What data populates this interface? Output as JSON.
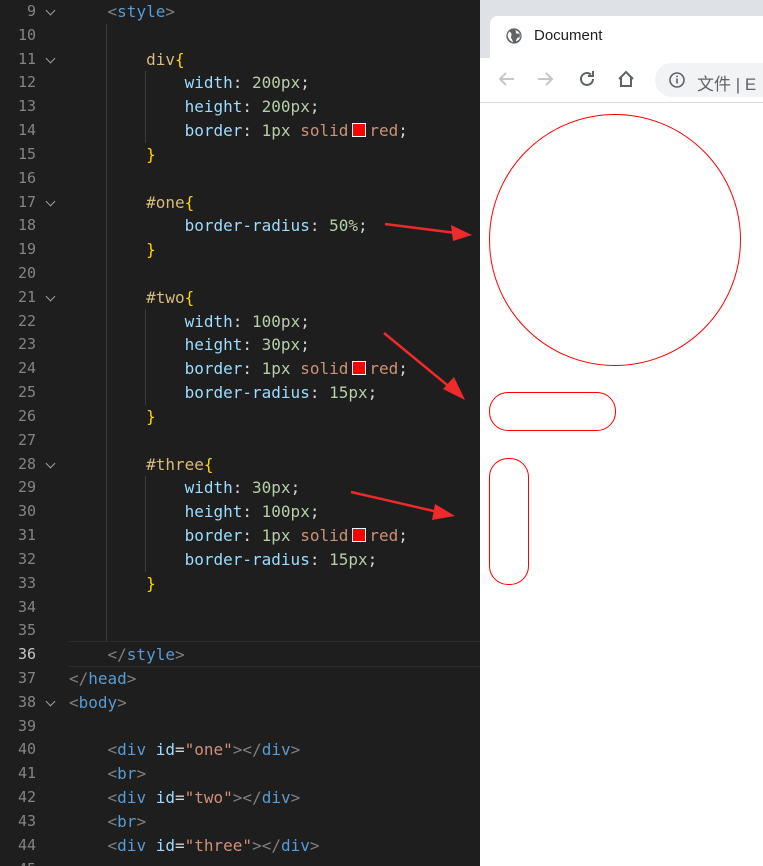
{
  "editor": {
    "active_line": "36",
    "lines": [
      {
        "n": "9",
        "fold": true,
        "segments": [
          {
            "t": "    ",
            "c": "plain"
          },
          {
            "t": "<",
            "c": "punc"
          },
          {
            "t": "style",
            "c": "tag"
          },
          {
            "t": ">",
            "c": "punc"
          }
        ]
      },
      {
        "n": "10",
        "fold": false,
        "segments": []
      },
      {
        "n": "11",
        "fold": true,
        "segments": [
          {
            "t": "        ",
            "c": "plain"
          },
          {
            "t": "div",
            "c": "sel"
          },
          {
            "t": "{",
            "c": "brace"
          }
        ]
      },
      {
        "n": "12",
        "fold": false,
        "segments": [
          {
            "t": "            ",
            "c": "plain"
          },
          {
            "t": "width",
            "c": "prop"
          },
          {
            "t": ": ",
            "c": "plain"
          },
          {
            "t": "200px",
            "c": "num"
          },
          {
            "t": ";",
            "c": "plain"
          }
        ]
      },
      {
        "n": "13",
        "fold": false,
        "segments": [
          {
            "t": "            ",
            "c": "plain"
          },
          {
            "t": "height",
            "c": "prop"
          },
          {
            "t": ": ",
            "c": "plain"
          },
          {
            "t": "200px",
            "c": "num"
          },
          {
            "t": ";",
            "c": "plain"
          }
        ]
      },
      {
        "n": "14",
        "fold": false,
        "segments": [
          {
            "t": "            ",
            "c": "plain"
          },
          {
            "t": "border",
            "c": "prop"
          },
          {
            "t": ": ",
            "c": "plain"
          },
          {
            "t": "1px",
            "c": "num"
          },
          {
            "t": " solid",
            "c": "val"
          },
          {
            "swatch": true
          },
          {
            "t": "red",
            "c": "val"
          },
          {
            "t": ";",
            "c": "plain"
          }
        ]
      },
      {
        "n": "15",
        "fold": false,
        "segments": [
          {
            "t": "        ",
            "c": "plain"
          },
          {
            "t": "}",
            "c": "brace"
          }
        ]
      },
      {
        "n": "16",
        "fold": false,
        "segments": []
      },
      {
        "n": "17",
        "fold": true,
        "segments": [
          {
            "t": "        ",
            "c": "plain"
          },
          {
            "t": "#one",
            "c": "sel"
          },
          {
            "t": "{",
            "c": "brace"
          }
        ]
      },
      {
        "n": "18",
        "fold": false,
        "segments": [
          {
            "t": "            ",
            "c": "plain"
          },
          {
            "t": "border-radius",
            "c": "prop"
          },
          {
            "t": ": ",
            "c": "plain"
          },
          {
            "t": "50%",
            "c": "num"
          },
          {
            "t": ";",
            "c": "plain"
          }
        ]
      },
      {
        "n": "19",
        "fold": false,
        "segments": [
          {
            "t": "        ",
            "c": "plain"
          },
          {
            "t": "}",
            "c": "brace"
          }
        ]
      },
      {
        "n": "20",
        "fold": false,
        "segments": []
      },
      {
        "n": "21",
        "fold": true,
        "segments": [
          {
            "t": "        ",
            "c": "plain"
          },
          {
            "t": "#two",
            "c": "sel"
          },
          {
            "t": "{",
            "c": "brace"
          }
        ]
      },
      {
        "n": "22",
        "fold": false,
        "segments": [
          {
            "t": "            ",
            "c": "plain"
          },
          {
            "t": "width",
            "c": "prop"
          },
          {
            "t": ": ",
            "c": "plain"
          },
          {
            "t": "100px",
            "c": "num"
          },
          {
            "t": ";",
            "c": "plain"
          }
        ]
      },
      {
        "n": "23",
        "fold": false,
        "segments": [
          {
            "t": "            ",
            "c": "plain"
          },
          {
            "t": "height",
            "c": "prop"
          },
          {
            "t": ": ",
            "c": "plain"
          },
          {
            "t": "30px",
            "c": "num"
          },
          {
            "t": ";",
            "c": "plain"
          }
        ]
      },
      {
        "n": "24",
        "fold": false,
        "segments": [
          {
            "t": "            ",
            "c": "plain"
          },
          {
            "t": "border",
            "c": "prop"
          },
          {
            "t": ": ",
            "c": "plain"
          },
          {
            "t": "1px",
            "c": "num"
          },
          {
            "t": " solid",
            "c": "val"
          },
          {
            "swatch": true
          },
          {
            "t": "red",
            "c": "val"
          },
          {
            "t": ";",
            "c": "plain"
          }
        ]
      },
      {
        "n": "25",
        "fold": false,
        "segments": [
          {
            "t": "            ",
            "c": "plain"
          },
          {
            "t": "border-radius",
            "c": "prop"
          },
          {
            "t": ": ",
            "c": "plain"
          },
          {
            "t": "15px",
            "c": "num"
          },
          {
            "t": ";",
            "c": "plain"
          }
        ]
      },
      {
        "n": "26",
        "fold": false,
        "segments": [
          {
            "t": "        ",
            "c": "plain"
          },
          {
            "t": "}",
            "c": "brace"
          }
        ]
      },
      {
        "n": "27",
        "fold": false,
        "segments": []
      },
      {
        "n": "28",
        "fold": true,
        "segments": [
          {
            "t": "        ",
            "c": "plain"
          },
          {
            "t": "#three",
            "c": "sel"
          },
          {
            "t": "{",
            "c": "brace"
          }
        ]
      },
      {
        "n": "29",
        "fold": false,
        "segments": [
          {
            "t": "            ",
            "c": "plain"
          },
          {
            "t": "width",
            "c": "prop"
          },
          {
            "t": ": ",
            "c": "plain"
          },
          {
            "t": "30px",
            "c": "num"
          },
          {
            "t": ";",
            "c": "plain"
          }
        ]
      },
      {
        "n": "30",
        "fold": false,
        "segments": [
          {
            "t": "            ",
            "c": "plain"
          },
          {
            "t": "height",
            "c": "prop"
          },
          {
            "t": ": ",
            "c": "plain"
          },
          {
            "t": "100px",
            "c": "num"
          },
          {
            "t": ";",
            "c": "plain"
          }
        ]
      },
      {
        "n": "31",
        "fold": false,
        "segments": [
          {
            "t": "            ",
            "c": "plain"
          },
          {
            "t": "border",
            "c": "prop"
          },
          {
            "t": ": ",
            "c": "plain"
          },
          {
            "t": "1px",
            "c": "num"
          },
          {
            "t": " solid",
            "c": "val"
          },
          {
            "swatch": true
          },
          {
            "t": "red",
            "c": "val"
          },
          {
            "t": ";",
            "c": "plain"
          }
        ]
      },
      {
        "n": "32",
        "fold": false,
        "segments": [
          {
            "t": "            ",
            "c": "plain"
          },
          {
            "t": "border-radius",
            "c": "prop"
          },
          {
            "t": ": ",
            "c": "plain"
          },
          {
            "t": "15px",
            "c": "num"
          },
          {
            "t": ";",
            "c": "plain"
          }
        ]
      },
      {
        "n": "33",
        "fold": false,
        "segments": [
          {
            "t": "        ",
            "c": "plain"
          },
          {
            "t": "}",
            "c": "brace"
          }
        ]
      },
      {
        "n": "34",
        "fold": false,
        "segments": []
      },
      {
        "n": "35",
        "fold": false,
        "segments": []
      },
      {
        "n": "36",
        "fold": false,
        "segments": [
          {
            "t": "    ",
            "c": "plain"
          },
          {
            "t": "</",
            "c": "punc"
          },
          {
            "t": "style",
            "c": "tag"
          },
          {
            "t": ">",
            "c": "punc"
          }
        ]
      },
      {
        "n": "37",
        "fold": false,
        "segments": [
          {
            "t": "</",
            "c": "punc"
          },
          {
            "t": "head",
            "c": "tag"
          },
          {
            "t": ">",
            "c": "punc"
          }
        ]
      },
      {
        "n": "38",
        "fold": true,
        "segments": [
          {
            "t": "<",
            "c": "punc"
          },
          {
            "t": "body",
            "c": "tag"
          },
          {
            "t": ">",
            "c": "punc"
          }
        ]
      },
      {
        "n": "39",
        "fold": false,
        "segments": []
      },
      {
        "n": "40",
        "fold": false,
        "segments": [
          {
            "t": "    ",
            "c": "plain"
          },
          {
            "t": "<",
            "c": "punc"
          },
          {
            "t": "div",
            "c": "tag"
          },
          {
            "t": " ",
            "c": "plain"
          },
          {
            "t": "id",
            "c": "attr"
          },
          {
            "t": "=",
            "c": "plain"
          },
          {
            "t": "\"one\"",
            "c": "str"
          },
          {
            "t": "></",
            "c": "punc"
          },
          {
            "t": "div",
            "c": "tag"
          },
          {
            "t": ">",
            "c": "punc"
          }
        ]
      },
      {
        "n": "41",
        "fold": false,
        "segments": [
          {
            "t": "    ",
            "c": "plain"
          },
          {
            "t": "<",
            "c": "punc"
          },
          {
            "t": "br",
            "c": "tag"
          },
          {
            "t": ">",
            "c": "punc"
          }
        ]
      },
      {
        "n": "42",
        "fold": false,
        "segments": [
          {
            "t": "    ",
            "c": "plain"
          },
          {
            "t": "<",
            "c": "punc"
          },
          {
            "t": "div",
            "c": "tag"
          },
          {
            "t": " ",
            "c": "plain"
          },
          {
            "t": "id",
            "c": "attr"
          },
          {
            "t": "=",
            "c": "plain"
          },
          {
            "t": "\"two\"",
            "c": "str"
          },
          {
            "t": "></",
            "c": "punc"
          },
          {
            "t": "div",
            "c": "tag"
          },
          {
            "t": ">",
            "c": "punc"
          }
        ]
      },
      {
        "n": "43",
        "fold": false,
        "segments": [
          {
            "t": "    ",
            "c": "plain"
          },
          {
            "t": "<",
            "c": "punc"
          },
          {
            "t": "br",
            "c": "tag"
          },
          {
            "t": ">",
            "c": "punc"
          }
        ]
      },
      {
        "n": "44",
        "fold": false,
        "segments": [
          {
            "t": "    ",
            "c": "plain"
          },
          {
            "t": "<",
            "c": "punc"
          },
          {
            "t": "div",
            "c": "tag"
          },
          {
            "t": " ",
            "c": "plain"
          },
          {
            "t": "id",
            "c": "attr"
          },
          {
            "t": "=",
            "c": "plain"
          },
          {
            "t": "\"three\"",
            "c": "str"
          },
          {
            "t": "></",
            "c": "punc"
          },
          {
            "t": "div",
            "c": "tag"
          },
          {
            "t": ">",
            "c": "punc"
          }
        ]
      },
      {
        "n": "45",
        "fold": false,
        "segments": []
      }
    ]
  },
  "browser": {
    "tab_title": "Document",
    "tab_icon": "globe-icon",
    "address_text": "文件 | E",
    "nav_icons": [
      "back-arrow-icon",
      "forward-arrow-icon",
      "reload-icon",
      "home-icon",
      "info-icon"
    ],
    "shape_border_color": "#ff0000"
  },
  "annotation_arrow_color": "#ee2a2a"
}
